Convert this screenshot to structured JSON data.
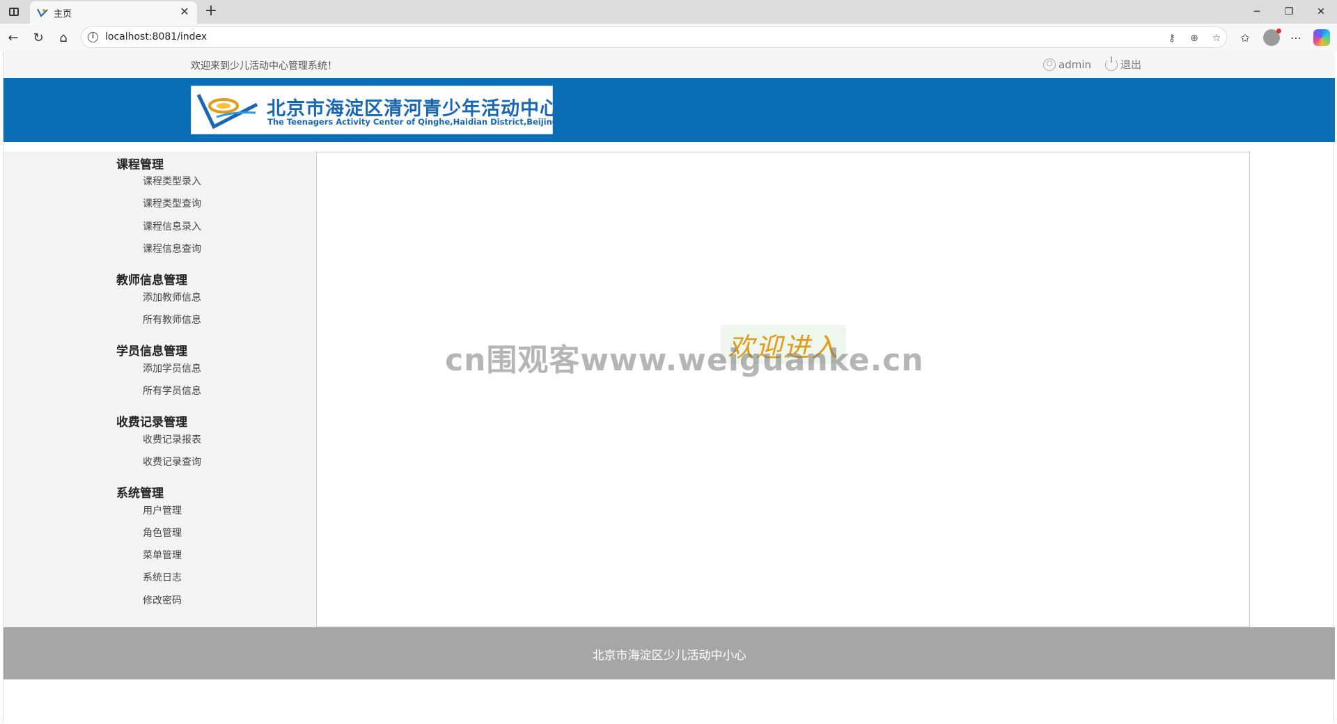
{
  "browser": {
    "tab_title": "主页",
    "url": "localhost:8081/index"
  },
  "topbar": {
    "welcome_text": "欢迎来到少儿活动中心管理系统！",
    "username": "admin",
    "logout_label": "退出"
  },
  "logo": {
    "title_cn": "北京市海淀区清河青少年活动中心",
    "title_en": "The Teenagers Activity Center of Qinghe,Haidian District,Beijing"
  },
  "sidebar": {
    "groups": [
      {
        "title": "课程管理",
        "items": [
          "课程类型录入",
          "课程类型查询",
          "课程信息录入",
          "课程信息查询"
        ]
      },
      {
        "title": "教师信息管理",
        "items": [
          "添加教师信息",
          "所有教师信息"
        ]
      },
      {
        "title": "学员信息管理",
        "items": [
          "添加学员信息",
          "所有学员信息"
        ]
      },
      {
        "title": "收费记录管理",
        "items": [
          "收费记录报表",
          "收费记录查询"
        ]
      },
      {
        "title": "系统管理",
        "items": [
          "用户管理",
          "角色管理",
          "菜单管理",
          "系统日志",
          "修改密码"
        ]
      }
    ]
  },
  "main": {
    "welcome_banner": "欢迎进入",
    "watermark": "cn围观客www.weiguanke.cn"
  },
  "footer": {
    "text": "北京市海淀区少儿活动中小心"
  },
  "colors": {
    "banner_blue": "#0a6eb4",
    "footer_gray": "#a6a6a6",
    "welcome_gold": "#e09b1a"
  }
}
